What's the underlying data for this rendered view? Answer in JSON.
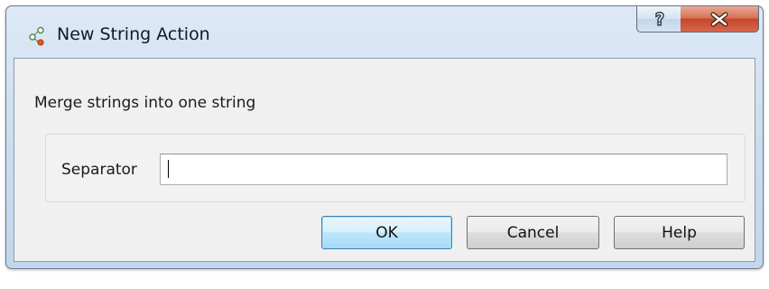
{
  "window": {
    "title": "New String Action",
    "app_icon": "connector-nodes-icon",
    "caption_buttons": {
      "help_glyph": "?",
      "close_glyph": "X"
    }
  },
  "dialog": {
    "description": "Merge strings into one string",
    "separator": {
      "label": "Separator",
      "value": "",
      "placeholder": ""
    },
    "buttons": {
      "ok": "OK",
      "cancel": "Cancel",
      "help": "Help"
    }
  },
  "colors": {
    "titlebar": "#cbdcef",
    "client_bg": "#f0f0f0",
    "close_button": "#c7452a",
    "default_button_border": "#3c7fb1"
  }
}
